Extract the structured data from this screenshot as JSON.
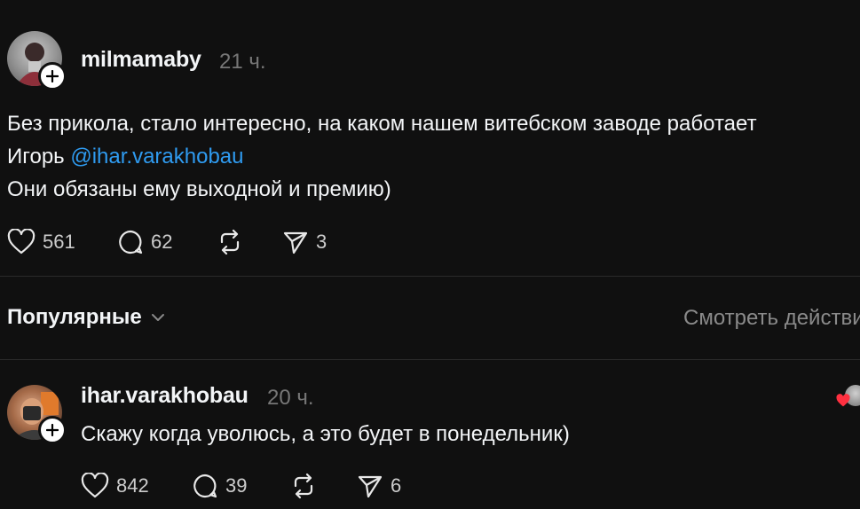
{
  "post": {
    "username": "milmamaby",
    "time": "21 ч.",
    "text_line1": "Без прикола, стало интересно, на каком нашем витебском заводе работает",
    "text_line2_prefix": "Игорь ",
    "mention": "@ihar.varakhobau",
    "text_line3": "Они обязаны ему выходной и премию)",
    "likes": "561",
    "comments": "62",
    "shares": "3"
  },
  "sort": {
    "label": "Популярные",
    "view_activity": "Смотреть действия"
  },
  "reply": {
    "username": "ihar.varakhobau",
    "time": "20 ч.",
    "text": "Скажу когда уволюсь, а это будет в понедельник)",
    "likes": "842",
    "comments": "39",
    "shares": "6"
  },
  "colors": {
    "background": "#101010",
    "mention": "#2f9bf0",
    "heart_liked": "#ff3040"
  }
}
